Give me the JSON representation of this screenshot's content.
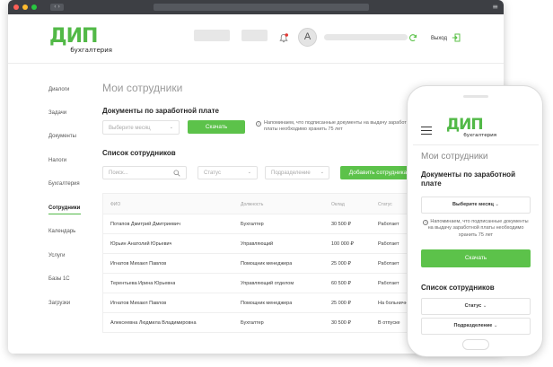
{
  "app": {
    "logo_mark": "ДИП",
    "logo_sub": "бухгалтерия",
    "avatar_letter": "А",
    "logout_label": "Выход",
    "colors": {
      "accent": "#5cc24a",
      "notify": "#e53935"
    }
  },
  "sidebar": {
    "items": [
      {
        "label": "Диалоги"
      },
      {
        "label": "Задачи"
      },
      {
        "label": "Документы"
      },
      {
        "label": "Налоги"
      },
      {
        "label": "Бухгалтерия"
      },
      {
        "label": "Сотрудники"
      },
      {
        "label": "Календарь"
      },
      {
        "label": "Услуги"
      },
      {
        "label": "Базы 1С"
      },
      {
        "label": "Загрузки"
      }
    ],
    "active": "Сотрудники"
  },
  "main": {
    "page_title": "Мои сотрудники",
    "salary_section_title": "Документы по заработной плате",
    "month_select_placeholder": "Выберите месяц",
    "download_label": "Скачать",
    "retention_note": "Напоминаем, что подписанные документы на выдачу заработной платы необходимо хранить 75 лет",
    "employees_title": "Список сотрудников",
    "search_placeholder": "Поиск...",
    "status_filter": "Статус",
    "department_filter": "Подразделение",
    "add_employee_label": "Добавить сотрудника",
    "table": {
      "headers": [
        "ФИО",
        "Должность",
        "Оклад",
        "Статус"
      ],
      "rows": [
        [
          "Потапов Дмитрий Дмитриевич",
          "Бухгалтер",
          "30 500 ₽",
          "Работает"
        ],
        [
          "Юрьин Анатолий Юрьевич",
          "Управляющий",
          "100 000 ₽",
          "Работает"
        ],
        [
          "Игнатов Михаил Павлов",
          "Помощник менеджера",
          "25 000 ₽",
          "Работает"
        ],
        [
          "Терентьева Ирина Юрьевна",
          "Управляющий отделом",
          "60 500 ₽",
          "Работает"
        ],
        [
          "Игнатов Михаил Павлов",
          "Помощник менеджера",
          "25 000 ₽",
          "На больничном"
        ],
        [
          "Алексеевна Людмила Владимировна",
          "Бухгалтер",
          "30 500 ₽",
          "В отпуске"
        ]
      ]
    }
  },
  "mobile": {
    "page_title": "Мои сотрудники",
    "salary_section_title": "Документы по заработной плате",
    "month_select": "Выберите месяц",
    "retention_note": "Напоминаем, что подписанные документы на выдачу заработной платы необходимо хранить 75 лет",
    "download_label": "Скачать",
    "employees_title": "Список сотрудников",
    "status_filter": "Статус",
    "department_filter": "Подразделение"
  }
}
